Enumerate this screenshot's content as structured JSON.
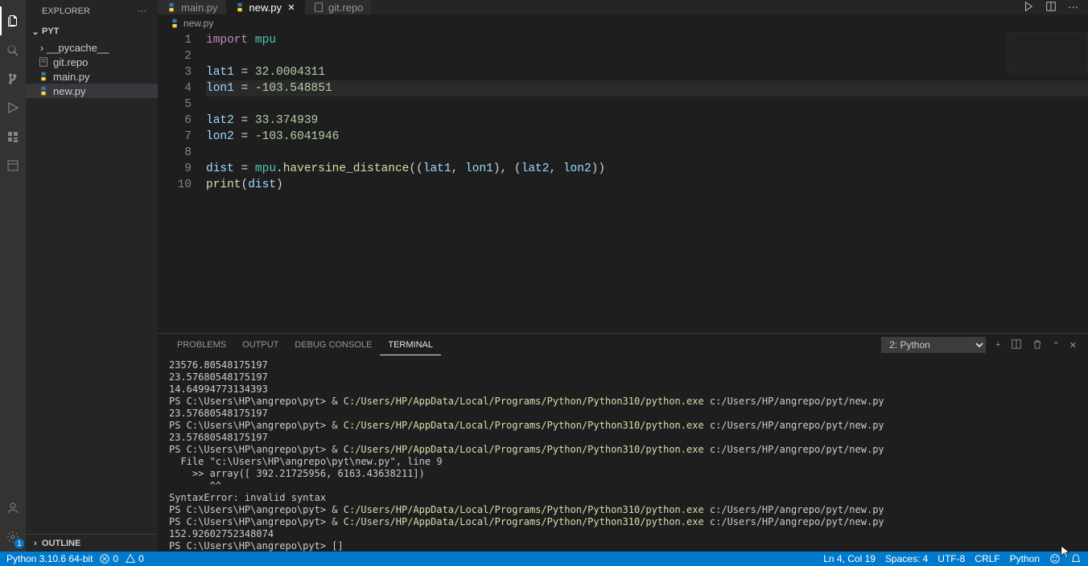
{
  "sidebar": {
    "title": "EXPLORER",
    "section": "PYT",
    "items": [
      {
        "label": "__pycache__",
        "icon": "folder"
      },
      {
        "label": "git.repo",
        "icon": "file"
      },
      {
        "label": "main.py",
        "icon": "python"
      },
      {
        "label": "new.py",
        "icon": "python"
      }
    ],
    "outline": "OUTLINE"
  },
  "tabs": [
    {
      "label": "main.py",
      "active": false
    },
    {
      "label": "new.py",
      "active": true
    },
    {
      "label": "git.repo",
      "active": false
    }
  ],
  "breadcrumb": "new.py",
  "code": {
    "lines": [
      {
        "n": "1",
        "text": "import mpu"
      },
      {
        "n": "2",
        "text": ""
      },
      {
        "n": "3",
        "text": "lat1 = 32.0004311"
      },
      {
        "n": "4",
        "text": "lon1 = -103.548851"
      },
      {
        "n": "5",
        "text": ""
      },
      {
        "n": "6",
        "text": "lat2 = 33.374939"
      },
      {
        "n": "7",
        "text": "lon2 = -103.6041946"
      },
      {
        "n": "8",
        "text": ""
      },
      {
        "n": "9",
        "text": "dist = mpu.haversine_distance((lat1, lon1), (lat2, lon2))"
      },
      {
        "n": "10",
        "text": "print(dist)"
      }
    ]
  },
  "panel": {
    "tabs": [
      "PROBLEMS",
      "OUTPUT",
      "DEBUG CONSOLE",
      "TERMINAL"
    ],
    "terminal_label": "2: Python",
    "output": {
      "line0": "23576.80548175197",
      "line1": "23.57680548175197",
      "line2": "14.64994773134393",
      "ps": "PS C:\\Users\\HP\\angrepo\\pyt> ",
      "amp": "& ",
      "pyexe": "C:/Users/HP/AppData/Local/Programs/Python/Python310/python.exe",
      "script": " c:/Users/HP/angrepo/pyt/new.py",
      "val_a": "23.57680548175197",
      "err1": "  File \"c:\\Users\\HP\\angrepo\\pyt\\new.py\", line 9",
      "err2": "    >> array([ 392.21725956, 6163.43638211])",
      "err3": "       ^^",
      "err4": "SyntaxError: invalid syntax",
      "val_b": "152.92602752348074",
      "cursor": "[]"
    }
  },
  "status": {
    "python": "Python 3.10.6 64-bit",
    "errors": "0",
    "warnings": "0",
    "ln": "Ln 4, Col 19",
    "spaces": "Spaces: 4",
    "enc": "UTF-8",
    "eol": "CRLF",
    "lang": "Python"
  },
  "settings_badge": "1"
}
